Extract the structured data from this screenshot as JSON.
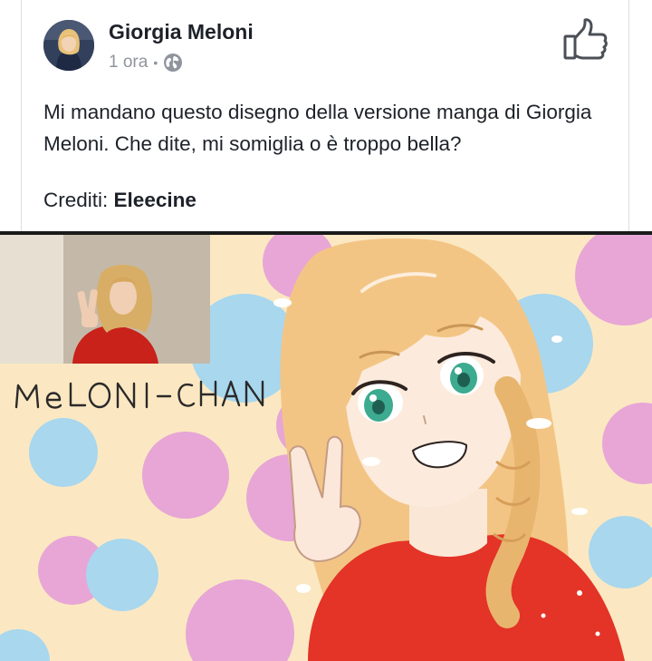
{
  "post": {
    "author": "Giorgia Meloni",
    "time": "1 ora",
    "separator": "•",
    "visibility_icon": "globe-icon",
    "action_icon": "like-icon",
    "text": "Mi mandano questo disegno della versione manga di Giorgia Meloni. Che dite, mi somiglia o è troppo bella?",
    "credits_label": "Crediti:",
    "credits_name": "Eleecine"
  },
  "image": {
    "caption_lettering": "MELONI-CHAN",
    "colors": {
      "background": "#fbe8c2",
      "pink_dots": "#e7a6d6",
      "blue_dots": "#a8d7ee",
      "hair": "#f3c585",
      "shirt": "#e43327",
      "eyes": "#3cab8f"
    }
  }
}
